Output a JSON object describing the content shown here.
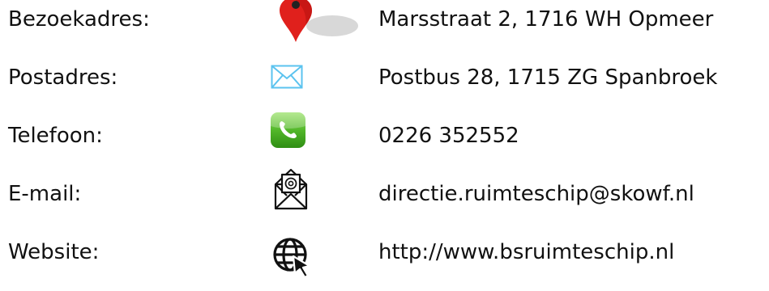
{
  "contact": {
    "rows": [
      {
        "label": "Bezoekadres:",
        "value": "Marsstraat 2, 1716 WH Opmeer",
        "icon": "map-pin-icon"
      },
      {
        "label": "Postadres:",
        "value": "Postbus 28, 1715 ZG Spanbroek",
        "icon": "envelope-icon"
      },
      {
        "label": "Telefoon:",
        "value": "0226 352552",
        "icon": "phone-icon"
      },
      {
        "label": "E-mail:",
        "value": "directie.ruimteschip@skowf.nl",
        "icon": "email-at-icon"
      },
      {
        "label": "Website:",
        "value": "http://www.bsruimteschip.nl",
        "icon": "globe-cursor-icon"
      }
    ]
  },
  "colors": {
    "pin_red": "#e0201c",
    "envelope_blue": "#5bc3ef",
    "phone_green": "#52b72a"
  }
}
